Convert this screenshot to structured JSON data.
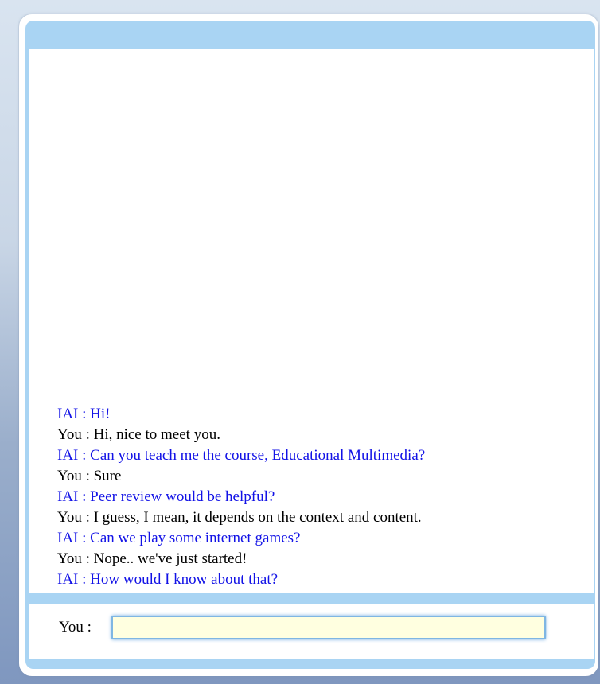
{
  "chat": {
    "messages": [
      {
        "speaker": "bot",
        "text": "IAI : Hi!"
      },
      {
        "speaker": "user",
        "text": "You : Hi, nice to meet you."
      },
      {
        "speaker": "bot",
        "text": "IAI : Can you teach me the course, Educational Multimedia?"
      },
      {
        "speaker": "user",
        "text": "You : Sure"
      },
      {
        "speaker": "bot",
        "text": "IAI : Peer review would be helpful?"
      },
      {
        "speaker": "user",
        "text": "You : I guess, I mean, it depends on the context and content."
      },
      {
        "speaker": "bot",
        "text": "IAI : Can we play some internet games?"
      },
      {
        "speaker": "user",
        "text": "You : Nope.. we've just started!"
      },
      {
        "speaker": "bot",
        "text": "IAI : How would I know about that?"
      }
    ]
  },
  "input": {
    "label": "You :",
    "value": "",
    "placeholder": ""
  },
  "colors": {
    "bot_text": "#1212e6",
    "user_text": "#000000",
    "frame_accent": "#a9d4f3",
    "input_background": "#ffffe0"
  }
}
